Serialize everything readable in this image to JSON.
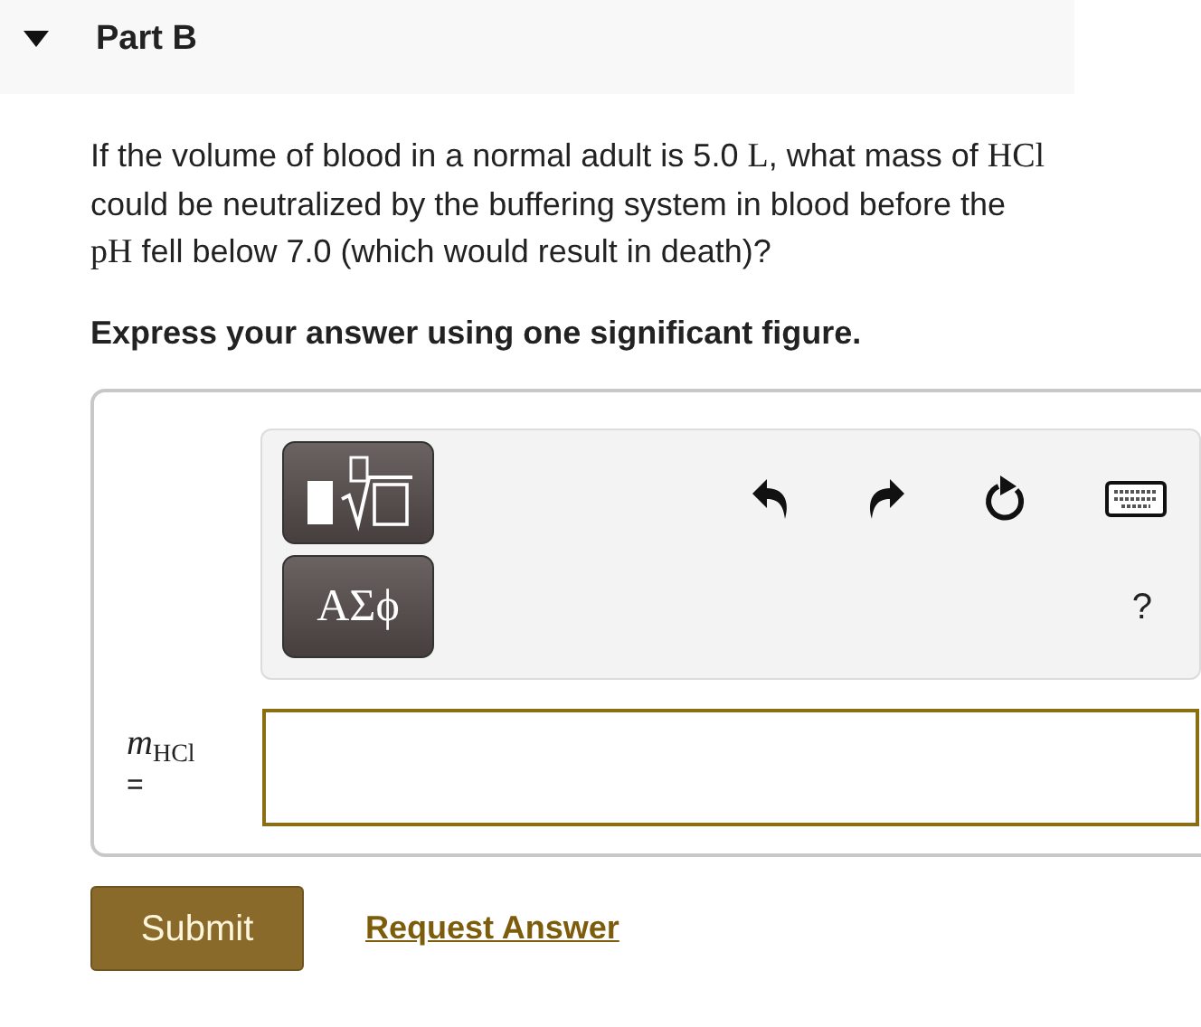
{
  "part": {
    "title": "Part B",
    "expanded": true
  },
  "question": [
    {
      "kind": "text",
      "text": "If the volume of blood in a normal adult is 5.0 "
    },
    {
      "kind": "math",
      "text": "L"
    },
    {
      "kind": "text",
      "text": ", what mass of "
    },
    {
      "kind": "math",
      "text": "HCl"
    },
    {
      "kind": "text",
      "text": " could be neutralized by the buffering system in blood before the "
    },
    {
      "kind": "math",
      "text": "pH"
    },
    {
      "kind": "text",
      "text": " fell below 7.0 (which would result in death)?"
    }
  ],
  "instruction": "Express your answer using one significant figure.",
  "toolbar": {
    "greek_button": "ΑΣϕ",
    "help": "?"
  },
  "answer": {
    "label": "*m*$_{HCl}$",
    "equals": "="
  },
  "buttons": {
    "submit": "Submit",
    "request": "Request Answer"
  }
}
